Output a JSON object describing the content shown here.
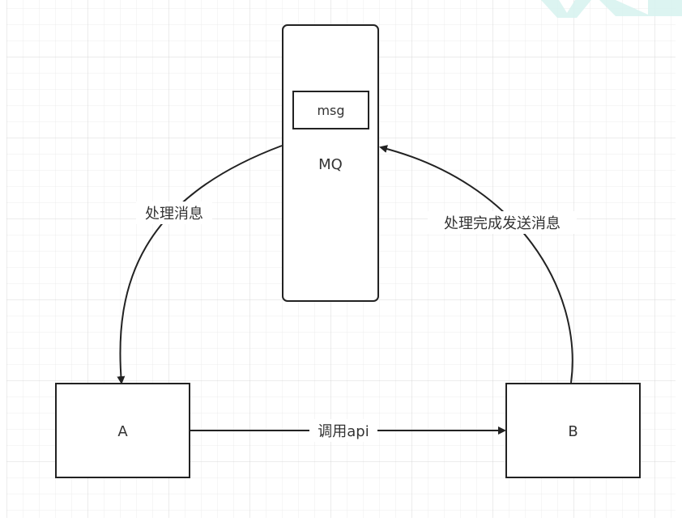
{
  "diagram": {
    "nodes": {
      "mq": {
        "label": "MQ",
        "inner_label": "msg"
      },
      "a": {
        "label": "A"
      },
      "b": {
        "label": "B"
      }
    },
    "edges": {
      "mq_to_a": {
        "label": "处理消息"
      },
      "b_to_mq": {
        "label": "处理完成发送消息"
      },
      "a_to_b": {
        "label": "调用api"
      }
    }
  },
  "colors": {
    "stroke": "#222222",
    "text": "#333333",
    "grid_minor": "#ececec",
    "grid_major": "#d9d9d9",
    "watermark": "#d8f3f0"
  }
}
